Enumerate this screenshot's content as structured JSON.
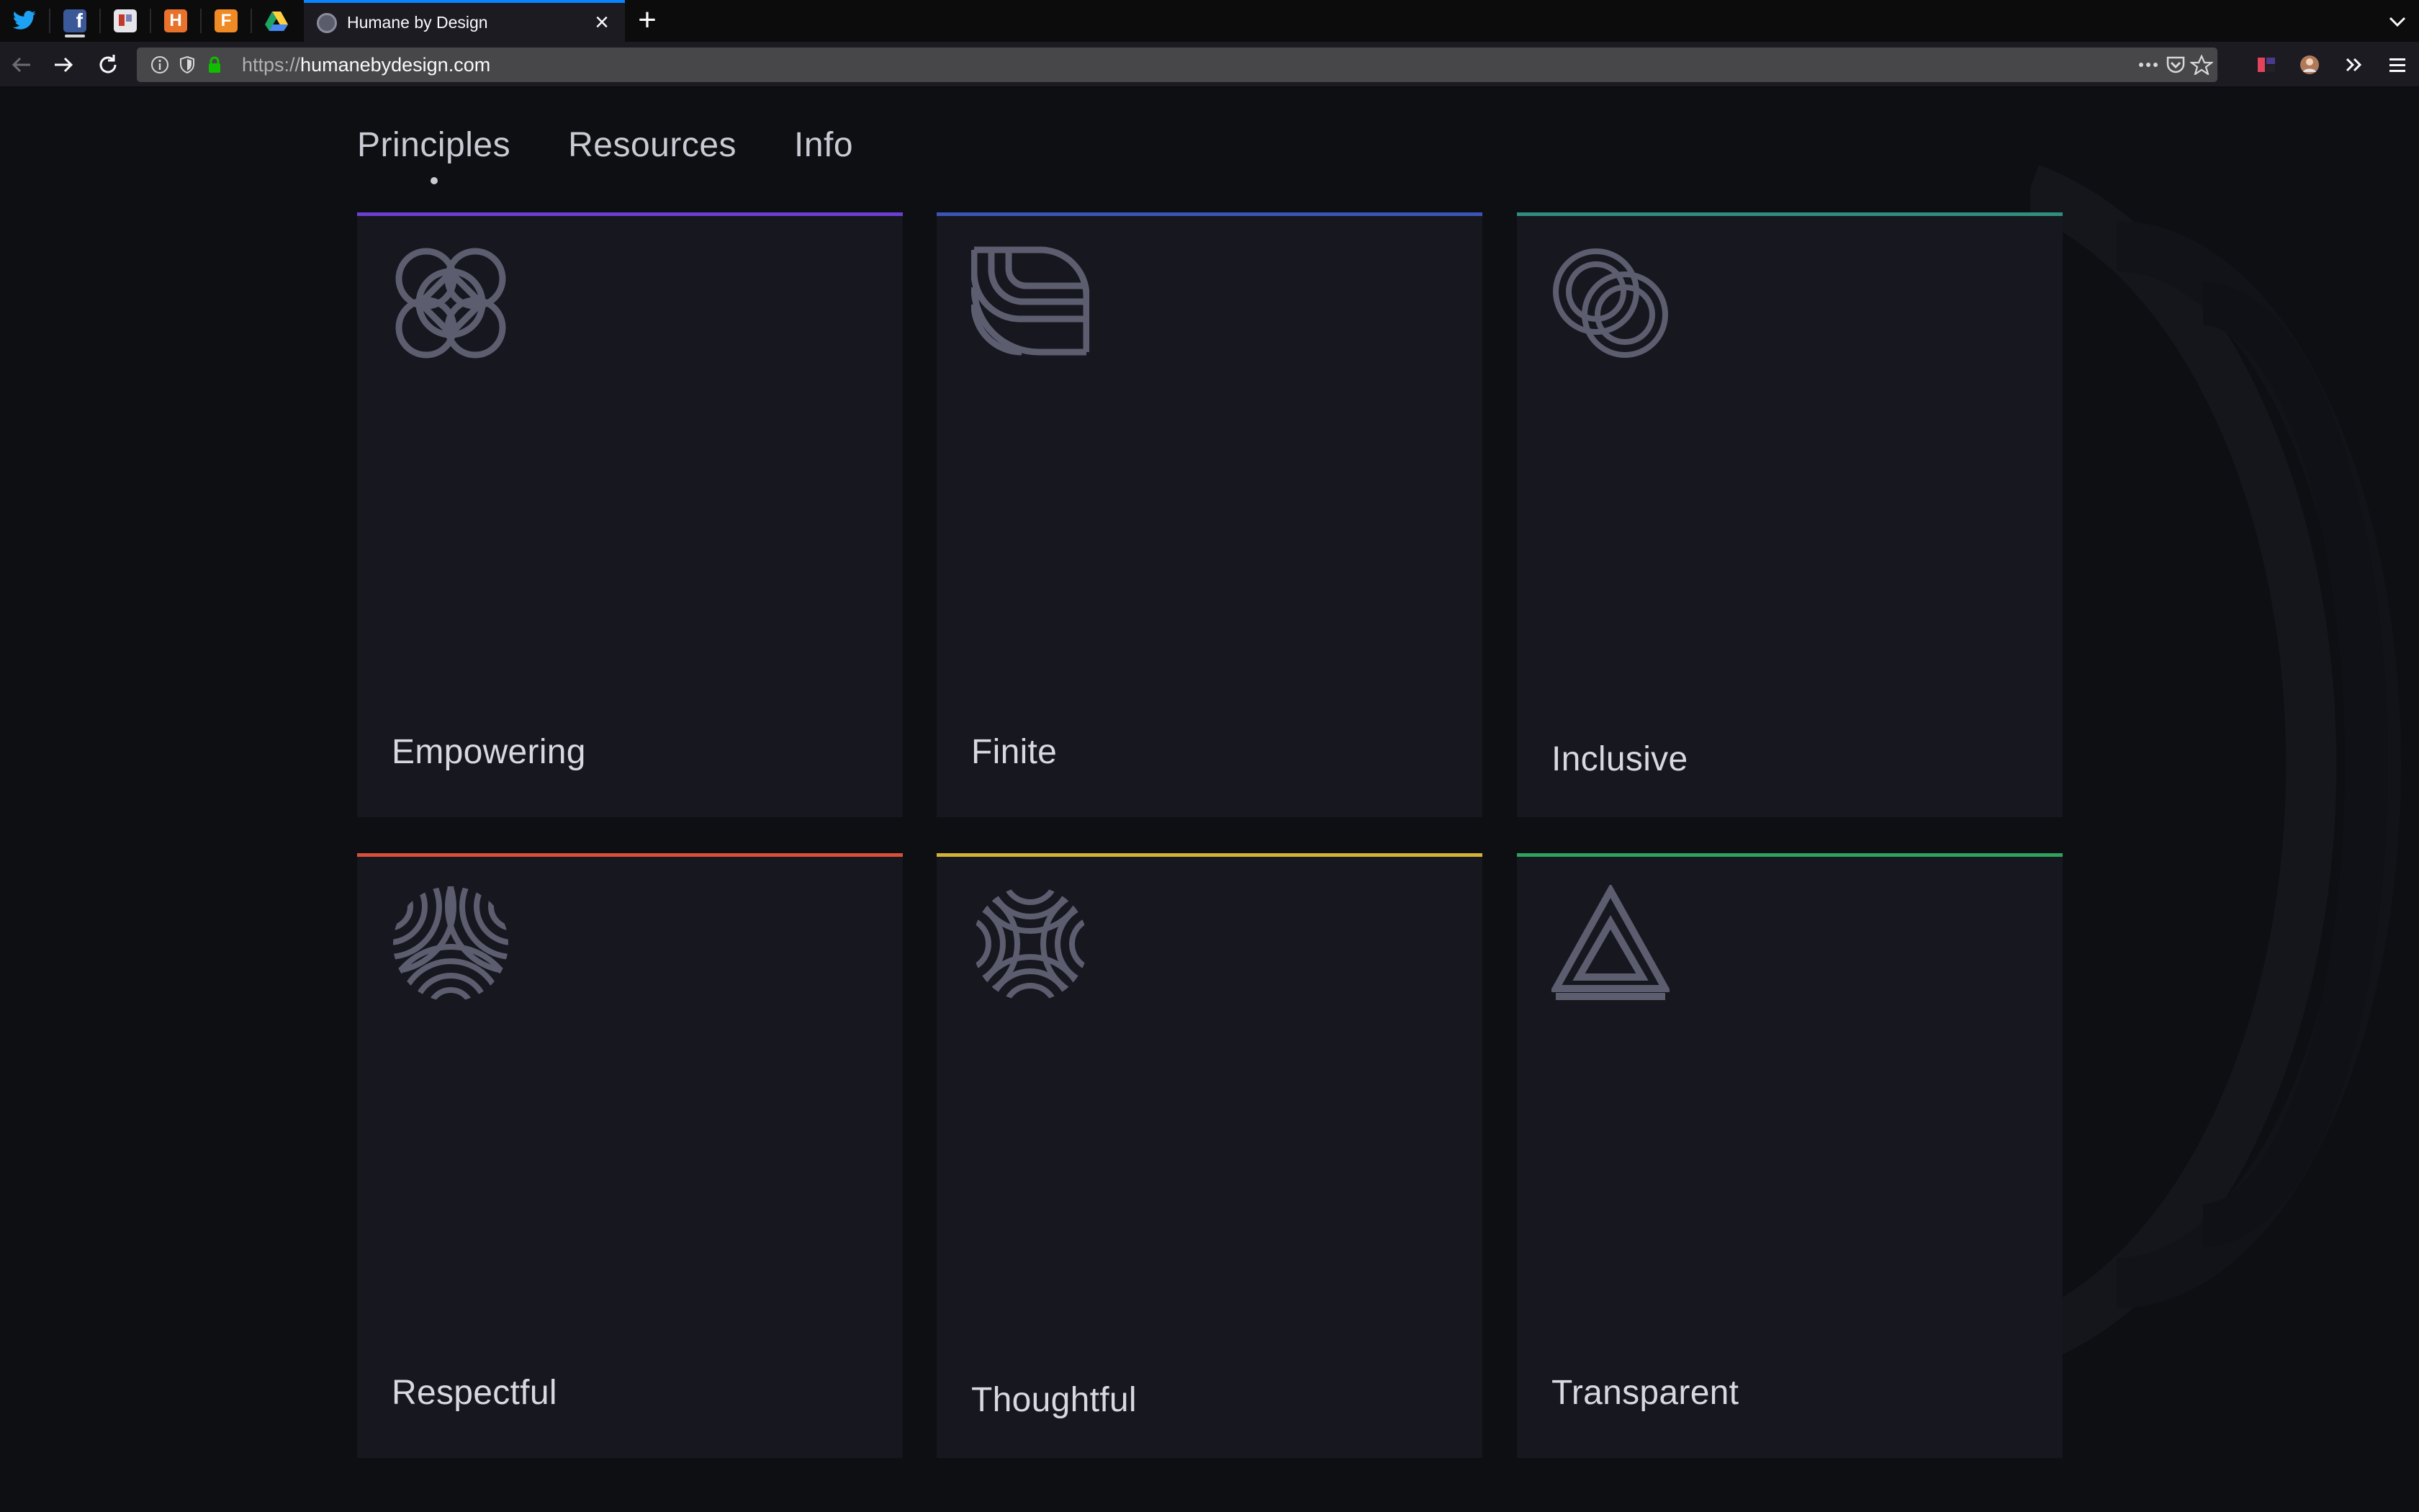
{
  "browser": {
    "pinned_tabs": [
      {
        "name": "twitter",
        "color": "#1da1f2"
      },
      {
        "name": "facebook",
        "color": "#3b5998"
      },
      {
        "name": "trello",
        "color": "#e2e2e2"
      },
      {
        "name": "h-app",
        "color": "#e8722c"
      },
      {
        "name": "f-app",
        "color": "#f08a24"
      },
      {
        "name": "google-drive",
        "color": "#1fa463"
      }
    ],
    "pinned_letters": {
      "h": "H",
      "f": "F"
    },
    "active_tab_title": "Humane by Design",
    "url_protocol": "https://",
    "url_host": "humanebydesign.com"
  },
  "site": {
    "nav": [
      {
        "label": "Principles",
        "active": true
      },
      {
        "label": "Resources",
        "active": false
      },
      {
        "label": "Info",
        "active": false
      }
    ],
    "principles": [
      {
        "label": "Empowering",
        "accent": "#6b3fd4",
        "icon": "interlocking-loops-icon"
      },
      {
        "label": "Finite",
        "accent": "#3a55b8",
        "icon": "finite-arcs-icon"
      },
      {
        "label": "Inclusive",
        "accent": "#2e8f7f",
        "icon": "linked-rings-icon"
      },
      {
        "label": "Respectful",
        "accent": "#d9503a",
        "icon": "three-petals-icon"
      },
      {
        "label": "Thoughtful",
        "accent": "#d4b236",
        "icon": "four-arcs-icon"
      },
      {
        "label": "Transparent",
        "accent": "#2fa35e",
        "icon": "nested-triangle-icon"
      }
    ],
    "icon_color": "#5c5e6f"
  }
}
